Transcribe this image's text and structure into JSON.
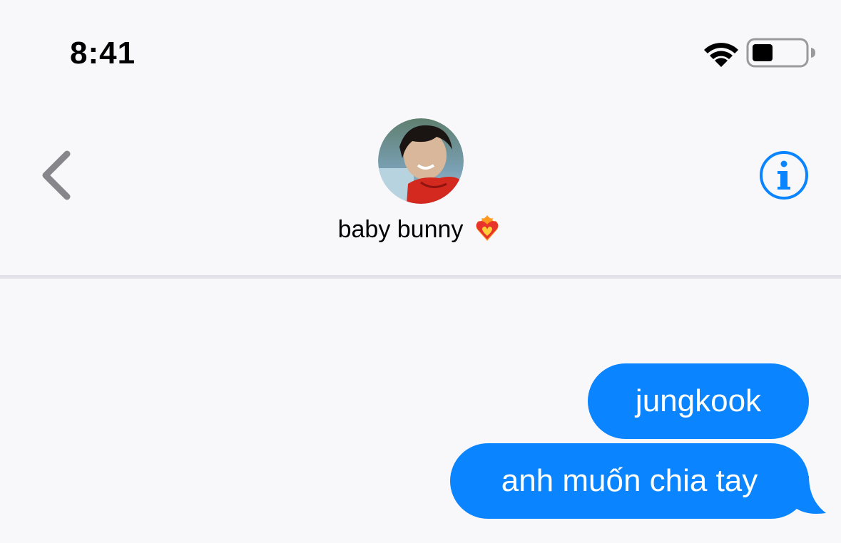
{
  "status_bar": {
    "time": "8:41",
    "wifi_icon": "wifi-icon",
    "battery_icon": "battery-icon"
  },
  "nav": {
    "back_icon": "chevron-left-icon",
    "contact_name": "baby bunny",
    "contact_emoji": "heart-on-fire",
    "info_icon": "info-icon"
  },
  "messages": [
    {
      "text": "jungkook",
      "direction": "outgoing"
    },
    {
      "text": "anh muốn chia tay",
      "direction": "outgoing"
    }
  ],
  "colors": {
    "background": "#f8f8fa",
    "bubble": "#0a84ff",
    "accent": "#0a84ff",
    "back_chevron": "#86868b"
  }
}
